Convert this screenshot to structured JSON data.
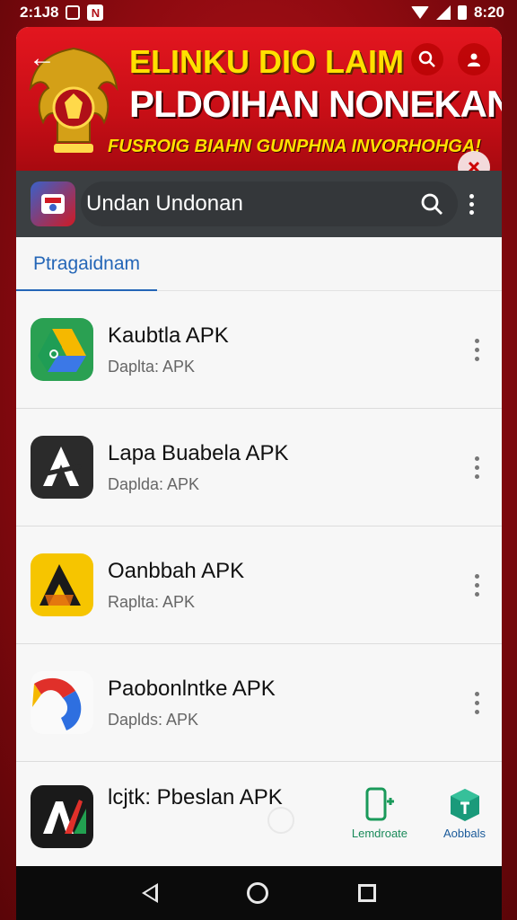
{
  "status_bar": {
    "time_left": "2:1J8",
    "notif_letter": "N",
    "time_right": "8:20"
  },
  "banner": {
    "title_line1": "ELINKU DIO LAIM",
    "title_line2": "PLDOIHAN NONEKAN",
    "subtitle": "FUSROIG BIAHN GUNPHNA INVORHOHGA!",
    "colors": {
      "primary": "#d9131c",
      "accent": "#ffe000"
    }
  },
  "toolbar": {
    "search_value": "Undan Undonan",
    "search_placeholder": "Undan Undonan"
  },
  "tabs": [
    {
      "label": "Ptragaidnam",
      "active": true
    }
  ],
  "apps": [
    {
      "name": "Kaubtla APK",
      "meta": "Daplta: APK",
      "icon": "drive-icon"
    },
    {
      "name": "Lapa Buabela APK",
      "meta": "Daplda: APK",
      "icon": "a-logo-icon"
    },
    {
      "name": "Oanbbah APK",
      "meta": "Raplta: APK",
      "icon": "yellow-a-icon"
    },
    {
      "name": "Paobonlntke APK",
      "meta": "Daplds: APK",
      "icon": "ribbon-icon"
    },
    {
      "name": "lcjtk: Pbeslan APK",
      "meta": "",
      "icon": "al-logo-icon"
    }
  ],
  "bottom_actions": [
    {
      "label": "Lemdroate",
      "icon": "phone-plus-icon"
    },
    {
      "label": "Aobbals",
      "icon": "package-icon"
    }
  ]
}
